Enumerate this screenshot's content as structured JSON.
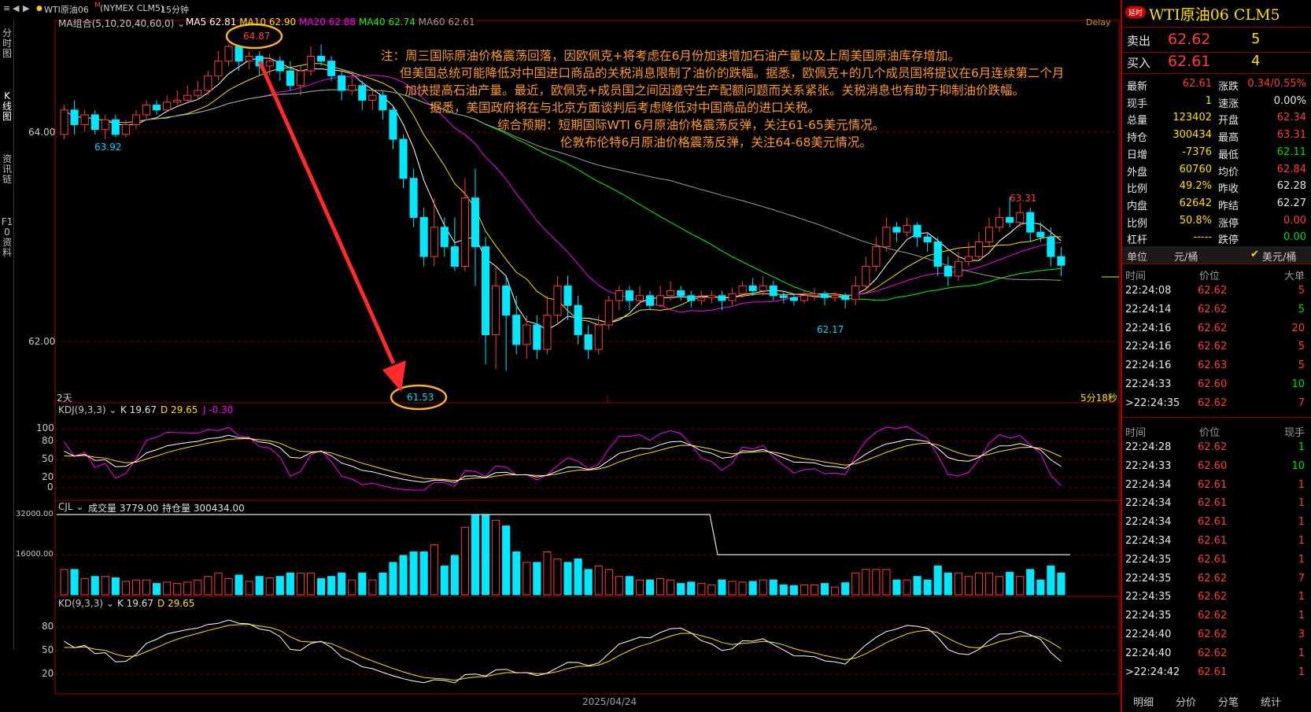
{
  "topbar": {
    "symbol_title": "WTI原油06",
    "symbol_flag": "M",
    "exchange": "(NYMEX CLM5)",
    "period": "15分钟"
  },
  "left_tabs": [
    "分时图",
    "K线图",
    "资讯链",
    "F10资料"
  ],
  "main_chart": {
    "ma_header": "MA组合(5,10,20,40,60,0)",
    "ma_items": [
      {
        "label": "MA5 62.81",
        "color": "#ffffff"
      },
      {
        "label": "MA10 62.90",
        "color": "#ffe000"
      },
      {
        "label": "MA20 62.88",
        "color": "#ff00ff"
      },
      {
        "label": "MA40 62.74",
        "color": "#00ff00"
      },
      {
        "label": "MA60 62.61",
        "color": "#9a9a9a"
      }
    ],
    "delay": "Delay",
    "y_ticks": [
      "64.00",
      "62.00"
    ],
    "high_label": "64.87",
    "low_label": "61.53",
    "label_6392": "63.92",
    "label_6331": "63.31",
    "label_6217": "62.17",
    "bottom_left": "2天",
    "bottom_right": "5分18秒"
  },
  "note": {
    "lines": [
      "注：周三国际原油价格震荡回落，因欧佩克+将考虑在6月份加速增加石油产量以及上周美国原油库存增加。",
      "但美国总统可能降低对中国进口商品的关税消息限制了油价的跌幅。据悉，欧佩克+的几个成员国将提议在6月连续第二个月",
      "加快提高石油产量。最近，欧佩克+成员国之间因遵守生产配额问题而关系紧张。关税消息也有助于抑制油价跌幅。",
      "据悉，美国政府将在与北京方面谈判后考虑降低对中国商品的进口关税。",
      "综合预期：短期国际WTI 6月原油价格震荡反弹，关注61-65美元情况。",
      "伦敦布伦特6月原油价格震荡反弹，关注64-68美元情况。"
    ]
  },
  "kdj_panel": {
    "header": "KDJ(9,3,3)",
    "k": "K 19.67",
    "d": "D 29.65",
    "j": "J -0.30",
    "y_ticks": [
      "100",
      "80",
      "50",
      "20",
      "0"
    ]
  },
  "cjl_panel": {
    "header": "CJL",
    "volume": "成交量 3779.00",
    "open_interest": "持仓量 300434.00",
    "y_ticks": [
      "32000.00",
      "16000.00"
    ]
  },
  "kd_panel": {
    "header": "KD(9,3,3)",
    "k": "K 19.67",
    "d": "D 29.65",
    "y_ticks": [
      "80",
      "50",
      "20"
    ],
    "date_label": "2025/04/24"
  },
  "quote_panel": {
    "badge": "延时",
    "title": "WTI原油06  CLM5",
    "sell_label": "卖出",
    "sell_price": "62.62",
    "sell_qty": "5",
    "buy_label": "买入",
    "buy_price": "62.61",
    "buy_qty": "4",
    "stats": [
      {
        "l1": "最新",
        "v1": "62.61",
        "c1": "red",
        "l2": "涨跌",
        "v2": "0.34/0.55%",
        "c2": "red"
      },
      {
        "l1": "现手",
        "v1": "1",
        "c1": "yellow",
        "l2": "速涨",
        "v2": "0.00%",
        "c2": "white"
      },
      {
        "l1": "总量",
        "v1": "123402",
        "c1": "yellow",
        "l2": "开盘",
        "v2": "62.34",
        "c2": "red"
      },
      {
        "l1": "持仓",
        "v1": "300434",
        "c1": "yellow",
        "l2": "最高",
        "v2": "63.31",
        "c2": "red"
      },
      {
        "l1": "日增",
        "v1": "-7376",
        "c1": "yellow",
        "l2": "最低",
        "v2": "62.11",
        "c2": "green"
      },
      {
        "l1": "外盘",
        "v1": "60760",
        "c1": "yellow",
        "l2": "均价",
        "v2": "62.84",
        "c2": "red"
      },
      {
        "l1": "比例",
        "v1": "49.2%",
        "c1": "yellow",
        "l2": "昨收",
        "v2": "62.28",
        "c2": "white"
      },
      {
        "l1": "内盘",
        "v1": "62642",
        "c1": "yellow",
        "l2": "昨结",
        "v2": "62.27",
        "c2": "white"
      },
      {
        "l1": "比例",
        "v1": "50.8%",
        "c1": "yellow",
        "l2": "涨停",
        "v2": "0.00",
        "c2": "red"
      },
      {
        "l1": "杠杆",
        "v1": "-----",
        "c1": "yellow",
        "l2": "跌停",
        "v2": "0.00",
        "c2": "green"
      }
    ],
    "unit_label": "单位",
    "unit_cny": "元/桶",
    "unit_usd": "美元/桶",
    "bigtrades_header": {
      "time": "时间",
      "price": "价位",
      "qty": "大单"
    },
    "bigtrades": [
      {
        "time": "22:24:08",
        "price": "62.62",
        "qty": "5",
        "qc": "red"
      },
      {
        "time": "22:24:14",
        "price": "62.62",
        "qty": "5",
        "qc": "green"
      },
      {
        "time": "22:24:16",
        "price": "62.62",
        "qty": "20",
        "qc": "red"
      },
      {
        "time": "22:24:16",
        "price": "62.62",
        "qty": "5",
        "qc": "red"
      },
      {
        "time": "22:24:16",
        "price": "62.63",
        "qty": "5",
        "qc": "red"
      },
      {
        "time": "22:24:33",
        "price": "62.60",
        "qty": "10",
        "qc": "green"
      },
      {
        "time": ">22:24:35",
        "price": "62.62",
        "qty": "7",
        "qc": "red"
      }
    ],
    "ticks_header": {
      "time": "时间",
      "price": "价位",
      "qty": "现手"
    },
    "ticks": [
      {
        "time": "22:24:28",
        "price": "62.62",
        "qty": "1",
        "qc": "green"
      },
      {
        "time": "22:24:33",
        "price": "62.60",
        "qty": "10",
        "qc": "green"
      },
      {
        "time": "22:24:34",
        "price": "62.61",
        "qty": "1",
        "qc": "red"
      },
      {
        "time": "22:24:34",
        "price": "62.61",
        "qty": "1",
        "qc": "red"
      },
      {
        "time": "22:24:34",
        "price": "62.61",
        "qty": "1",
        "qc": "red"
      },
      {
        "time": "22:24:34",
        "price": "62.61",
        "qty": "1",
        "qc": "red"
      },
      {
        "time": "22:24:35",
        "price": "62.61",
        "qty": "1",
        "qc": "red"
      },
      {
        "time": "22:24:35",
        "price": "62.62",
        "qty": "7",
        "qc": "red"
      },
      {
        "time": "22:24:35",
        "price": "62.62",
        "qty": "1",
        "qc": "red"
      },
      {
        "time": "22:24:35",
        "price": "62.62",
        "qty": "1",
        "qc": "red"
      },
      {
        "time": "22:24:40",
        "price": "62.62",
        "qty": "3",
        "qc": "red"
      },
      {
        "time": "22:24:40",
        "price": "62.62",
        "qty": "1",
        "qc": "red"
      },
      {
        "time": ">22:24:42",
        "price": "62.61",
        "qty": "1",
        "qc": "red"
      }
    ],
    "bottom_tabs": [
      "明细",
      "分价",
      "分笔",
      "统计"
    ]
  },
  "chart_data": {
    "type": "candlestick",
    "period": "15分钟",
    "y_range": [
      61.3,
      65.1
    ],
    "candles": [
      [
        63.95,
        64.2,
        64.25,
        63.9
      ],
      [
        64.2,
        64.05,
        64.3,
        63.95
      ],
      [
        64.05,
        64.15,
        64.2,
        63.98
      ],
      [
        64.15,
        64.0,
        64.2,
        63.95
      ],
      [
        64.0,
        64.1,
        64.15,
        63.9
      ],
      [
        64.1,
        63.95,
        64.15,
        63.92
      ],
      [
        63.95,
        64.05,
        64.1,
        63.92
      ],
      [
        64.05,
        64.15,
        64.2,
        64.0
      ],
      [
        64.15,
        64.25,
        64.3,
        64.1
      ],
      [
        64.25,
        64.2,
        64.3,
        64.15
      ],
      [
        64.2,
        64.28,
        64.35,
        64.18
      ],
      [
        64.28,
        64.3,
        64.4,
        64.25
      ],
      [
        64.3,
        64.35,
        64.45,
        64.28
      ],
      [
        64.35,
        64.4,
        64.5,
        64.3
      ],
      [
        64.4,
        64.55,
        64.6,
        64.35
      ],
      [
        64.55,
        64.7,
        64.8,
        64.5
      ],
      [
        64.7,
        64.85,
        64.87,
        64.65
      ],
      [
        64.85,
        64.7,
        64.87,
        64.6
      ],
      [
        64.7,
        64.75,
        64.8,
        64.62
      ],
      [
        64.75,
        64.65,
        64.8,
        64.55
      ],
      [
        64.65,
        64.7,
        64.78,
        64.55
      ],
      [
        64.7,
        64.6,
        64.75,
        64.5
      ],
      [
        64.6,
        64.45,
        64.7,
        64.4
      ],
      [
        64.45,
        64.6,
        64.65,
        64.35
      ],
      [
        64.6,
        64.75,
        64.85,
        64.55
      ],
      [
        64.75,
        64.7,
        64.87,
        64.65
      ],
      [
        64.7,
        64.55,
        64.75,
        64.5
      ],
      [
        64.55,
        64.4,
        64.6,
        64.3
      ],
      [
        64.4,
        64.45,
        64.55,
        64.35
      ],
      [
        64.45,
        64.3,
        64.5,
        64.2
      ],
      [
        64.3,
        64.35,
        64.4,
        64.2
      ],
      [
        64.35,
        64.2,
        64.4,
        64.1
      ],
      [
        64.2,
        63.9,
        64.25,
        63.8
      ],
      [
        63.9,
        63.5,
        63.95,
        63.4
      ],
      [
        63.5,
        63.1,
        63.6,
        63.0
      ],
      [
        63.1,
        62.7,
        63.2,
        62.6
      ],
      [
        62.7,
        63.0,
        63.3,
        62.6
      ],
      [
        63.0,
        62.8,
        63.1,
        62.7
      ],
      [
        62.8,
        62.6,
        63.1,
        62.55
      ],
      [
        62.6,
        63.3,
        63.5,
        62.55
      ],
      [
        63.3,
        62.8,
        63.6,
        62.4
      ],
      [
        62.8,
        61.9,
        62.9,
        61.6
      ],
      [
        61.9,
        62.4,
        62.6,
        61.55
      ],
      [
        62.4,
        62.1,
        62.5,
        61.53
      ],
      [
        62.1,
        61.8,
        62.3,
        61.7
      ],
      [
        61.8,
        62.0,
        62.1,
        61.65
      ],
      [
        62.0,
        61.75,
        62.1,
        61.65
      ],
      [
        61.75,
        62.1,
        62.3,
        61.7
      ],
      [
        62.1,
        62.4,
        62.5,
        62.0
      ],
      [
        62.4,
        62.2,
        62.5,
        62.05
      ],
      [
        62.2,
        61.9,
        62.3,
        61.8
      ],
      [
        61.9,
        61.75,
        62.0,
        61.65
      ],
      [
        61.75,
        62.0,
        62.1,
        61.7
      ],
      [
        62.0,
        62.25,
        62.3,
        61.95
      ],
      [
        62.25,
        62.35,
        62.4,
        62.15
      ],
      [
        62.35,
        62.25,
        62.4,
        62.15
      ],
      [
        62.25,
        62.3,
        62.4,
        62.2
      ],
      [
        62.3,
        62.2,
        62.35,
        62.15
      ],
      [
        62.2,
        62.3,
        62.4,
        62.18
      ],
      [
        62.3,
        62.35,
        62.45,
        62.25
      ],
      [
        62.35,
        62.3,
        62.4,
        62.25
      ],
      [
        62.3,
        62.25,
        62.35,
        62.18
      ],
      [
        62.25,
        62.28,
        62.35,
        62.2
      ],
      [
        62.28,
        62.3,
        62.35,
        62.22
      ],
      [
        62.3,
        62.25,
        62.35,
        62.15
      ],
      [
        62.25,
        62.32,
        62.38,
        62.2
      ],
      [
        62.32,
        62.4,
        62.45,
        62.28
      ],
      [
        62.4,
        62.35,
        62.48,
        62.3
      ],
      [
        62.35,
        62.4,
        62.5,
        62.3
      ],
      [
        62.4,
        62.3,
        62.45,
        62.25
      ],
      [
        62.3,
        62.28,
        62.35,
        62.22
      ],
      [
        62.28,
        62.25,
        62.32,
        62.2
      ],
      [
        62.25,
        62.3,
        62.35,
        62.22
      ],
      [
        62.3,
        62.32,
        62.38,
        62.25
      ],
      [
        62.32,
        62.28,
        62.35,
        62.2
      ],
      [
        62.28,
        62.3,
        62.34,
        62.24
      ],
      [
        62.3,
        62.26,
        62.33,
        62.17
      ],
      [
        62.26,
        62.4,
        62.5,
        62.2
      ],
      [
        62.4,
        62.6,
        62.7,
        62.35
      ],
      [
        62.6,
        62.8,
        62.9,
        62.55
      ],
      [
        62.8,
        63.0,
        63.1,
        62.75
      ],
      [
        63.0,
        62.95,
        63.05,
        62.85
      ],
      [
        62.95,
        63.02,
        63.1,
        62.9
      ],
      [
        63.02,
        62.9,
        63.05,
        62.8
      ],
      [
        62.9,
        62.85,
        62.95,
        62.75
      ],
      [
        62.85,
        62.6,
        62.9,
        62.5
      ],
      [
        62.6,
        62.5,
        62.7,
        62.4
      ],
      [
        62.5,
        62.65,
        62.75,
        62.45
      ],
      [
        62.65,
        62.7,
        62.85,
        62.6
      ],
      [
        62.7,
        62.85,
        62.95,
        62.65
      ],
      [
        62.85,
        63.0,
        63.1,
        62.8
      ],
      [
        63.0,
        63.1,
        63.2,
        62.95
      ],
      [
        63.1,
        63.05,
        63.31,
        63.0
      ],
      [
        63.05,
        63.15,
        63.25,
        63.0
      ],
      [
        63.15,
        62.95,
        63.2,
        62.85
      ],
      [
        62.95,
        62.9,
        63.05,
        62.85
      ],
      [
        62.9,
        62.7,
        63.0,
        62.6
      ],
      [
        62.7,
        62.61,
        62.8,
        62.5
      ]
    ]
  }
}
